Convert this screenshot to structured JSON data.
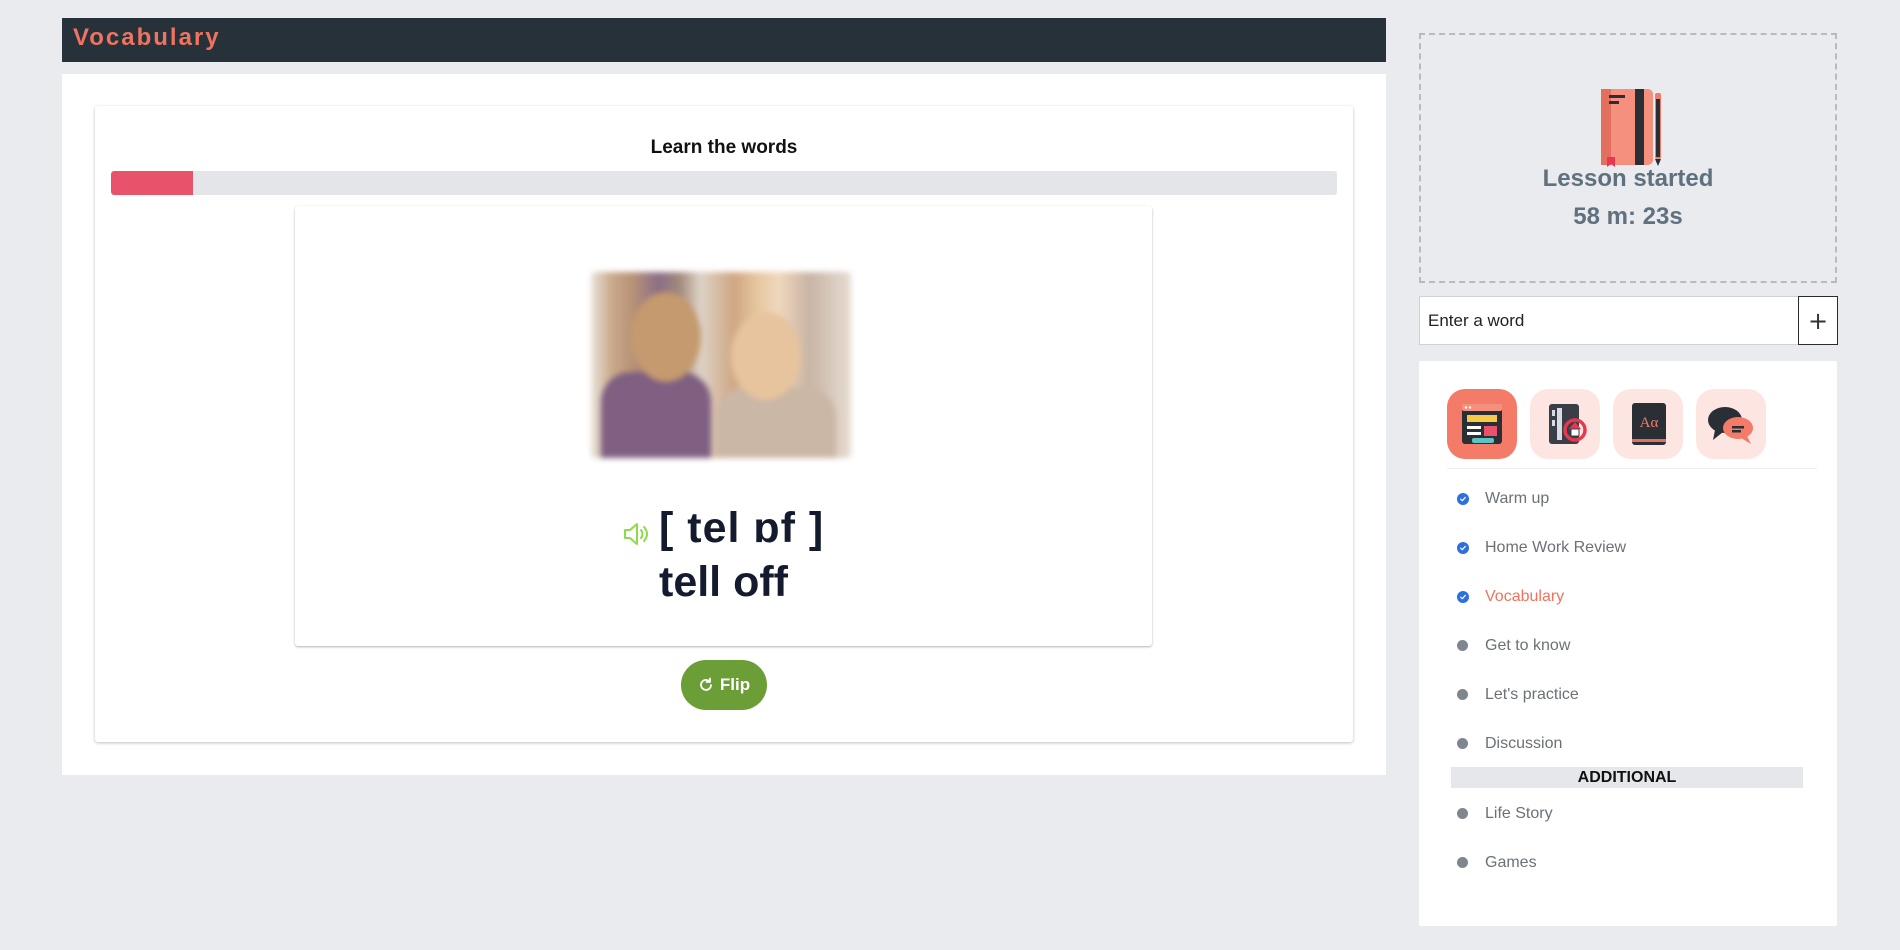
{
  "header": {
    "title": "Vocabulary"
  },
  "card": {
    "title": "Learn the words",
    "progress_fraction": 0.067,
    "phonetic": "[ tel ɒf ]",
    "word": "tell off",
    "flip_label": "Flip"
  },
  "timer": {
    "label": "Lesson started",
    "value": "58 m: 23s"
  },
  "word_entry": {
    "placeholder": "Enter a word",
    "add_label": "+"
  },
  "categories": [
    {
      "icon": "lesson-plan-icon",
      "active": true
    },
    {
      "icon": "homework-icon",
      "active": false
    },
    {
      "icon": "dictionary-icon",
      "active": false
    },
    {
      "icon": "discussion-icon",
      "active": false
    }
  ],
  "lessons": [
    {
      "label": "Warm up",
      "done": true
    },
    {
      "label": "Home Work Review",
      "done": true
    },
    {
      "label": "Vocabulary",
      "done": true,
      "active": true
    },
    {
      "label": "Get to know",
      "done": false
    },
    {
      "label": "Let's practice",
      "done": false
    },
    {
      "label": "Discussion",
      "done": false
    }
  ],
  "additional": {
    "heading": "ADDITIONAL",
    "items": [
      {
        "label": "Life Story"
      },
      {
        "label": "Games"
      }
    ]
  },
  "colors": {
    "accent": "#f0735f",
    "progress": "#e8536b",
    "flip": "#6b9e36",
    "check": "#2b6fe0"
  }
}
